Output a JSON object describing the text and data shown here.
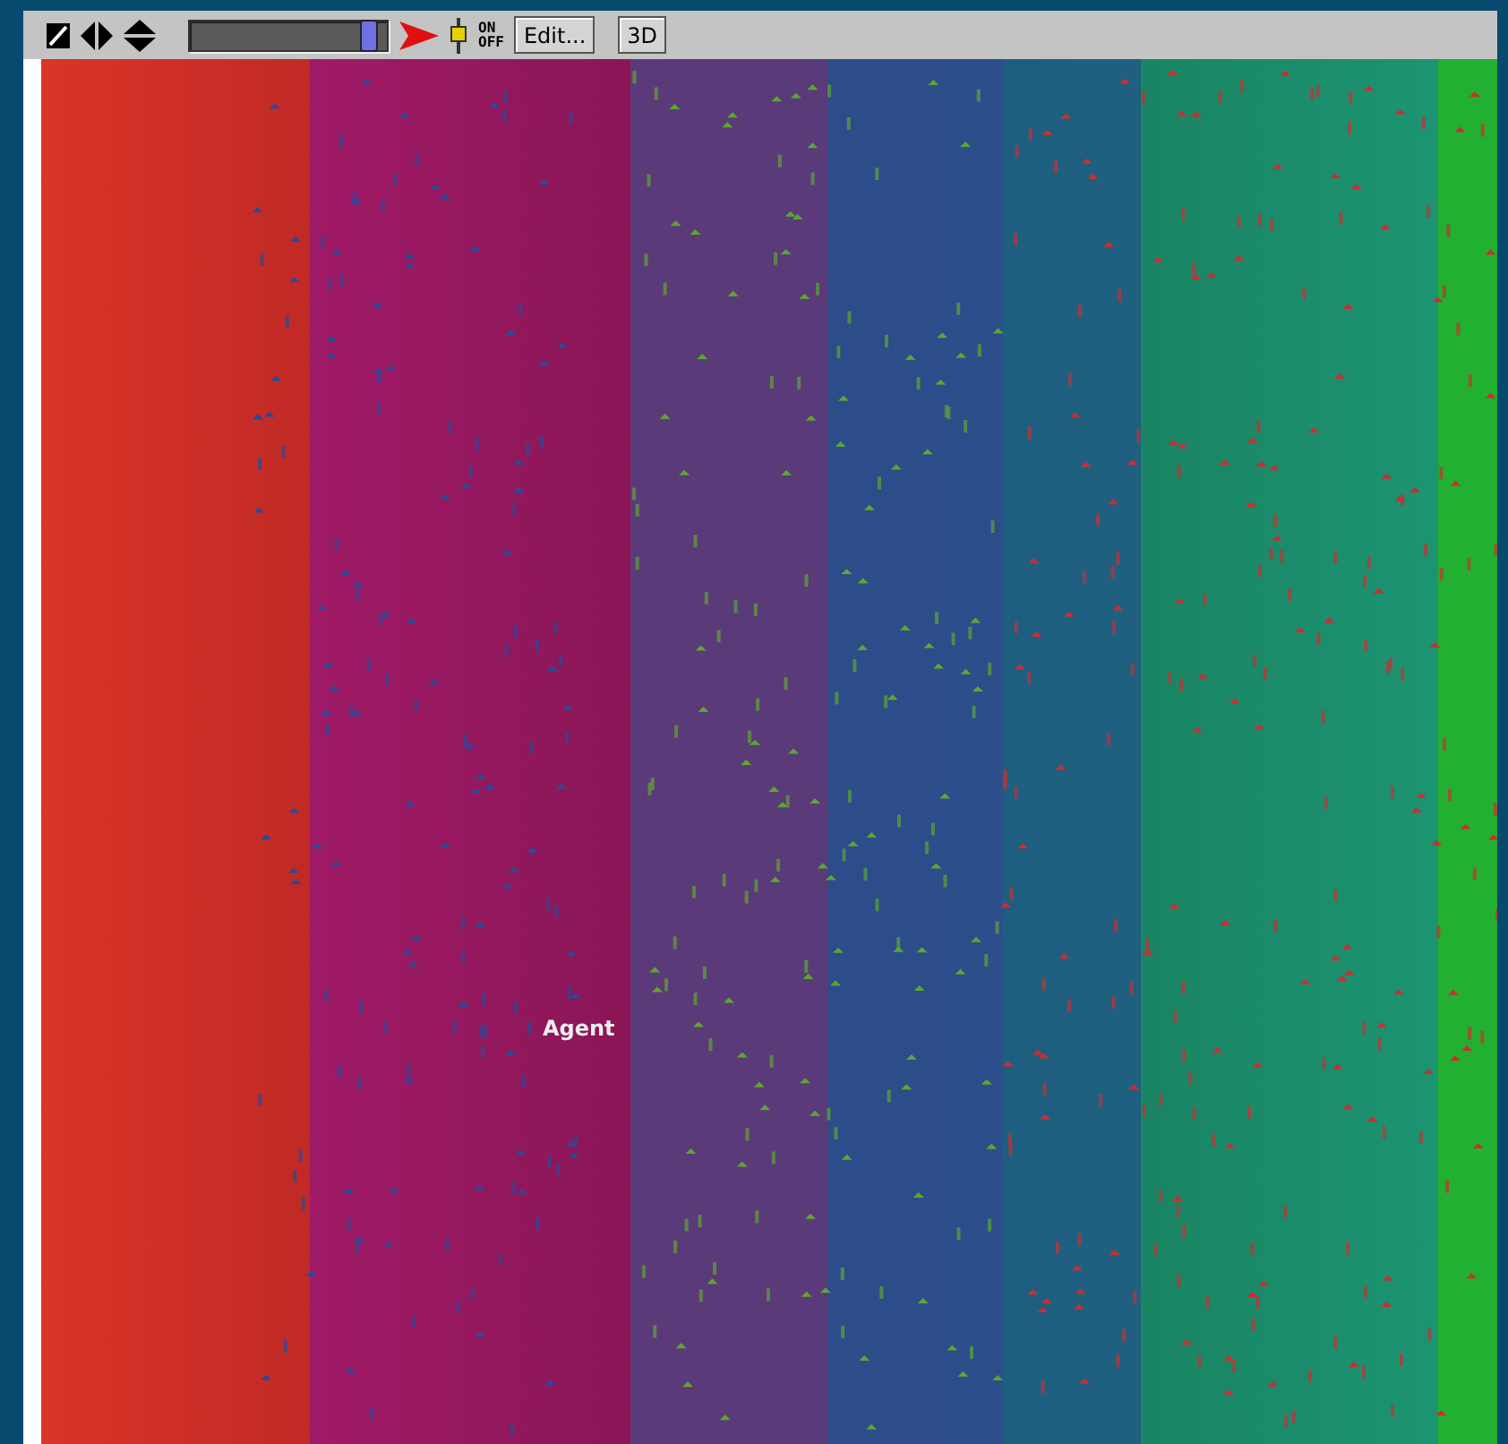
{
  "toolbar": {
    "speed_slider": {
      "level": 0.95
    },
    "switch": {
      "on_label": "ON",
      "off_label": "OFF"
    },
    "buttons": [
      {
        "kind": "edit",
        "label": "Edit..."
      },
      {
        "kind": "view",
        "label": "3D"
      }
    ]
  },
  "world": {
    "bands": [
      {
        "color": "#dc3428"
      },
      {
        "color": "#a01a66"
      },
      {
        "color": "#5c3a7a"
      },
      {
        "color": "#2c4c8a"
      },
      {
        "color": "#1e5e80"
      },
      {
        "color": "#1a8464"
      },
      {
        "color": "#22b030"
      }
    ],
    "label": "Agent"
  }
}
